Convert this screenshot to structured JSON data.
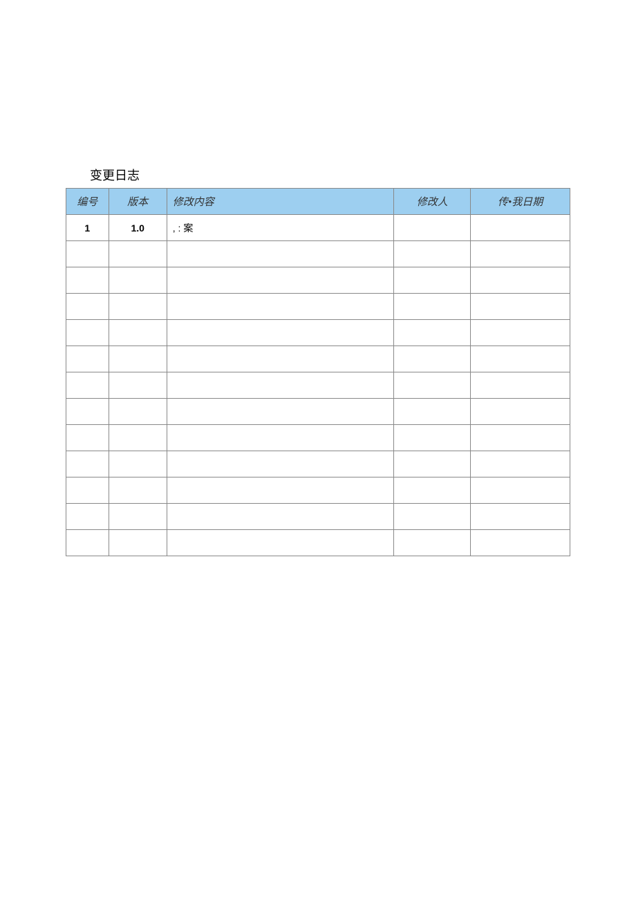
{
  "title": "变更日志",
  "headers": {
    "num": "编号",
    "version": "版本",
    "content": "修改内容",
    "person": "修改人",
    "date": "传•我日期"
  },
  "rows": [
    {
      "num": "1",
      "version": "1.0",
      "content": ", : 案",
      "person": "",
      "date": ""
    },
    {
      "num": "",
      "version": "",
      "content": "",
      "person": "",
      "date": ""
    },
    {
      "num": "",
      "version": "",
      "content": "",
      "person": "",
      "date": ""
    },
    {
      "num": "",
      "version": "",
      "content": "",
      "person": "",
      "date": ""
    },
    {
      "num": "",
      "version": "",
      "content": "",
      "person": "",
      "date": ""
    },
    {
      "num": "",
      "version": "",
      "content": "",
      "person": "",
      "date": ""
    },
    {
      "num": "",
      "version": "",
      "content": "",
      "person": "",
      "date": ""
    },
    {
      "num": "",
      "version": "",
      "content": "",
      "person": "",
      "date": ""
    },
    {
      "num": "",
      "version": "",
      "content": "",
      "person": "",
      "date": ""
    },
    {
      "num": "",
      "version": "",
      "content": "",
      "person": "",
      "date": ""
    },
    {
      "num": "",
      "version": "",
      "content": "",
      "person": "",
      "date": ""
    },
    {
      "num": "",
      "version": "",
      "content": "",
      "person": "",
      "date": ""
    },
    {
      "num": "",
      "version": "",
      "content": "",
      "person": "",
      "date": ""
    }
  ]
}
